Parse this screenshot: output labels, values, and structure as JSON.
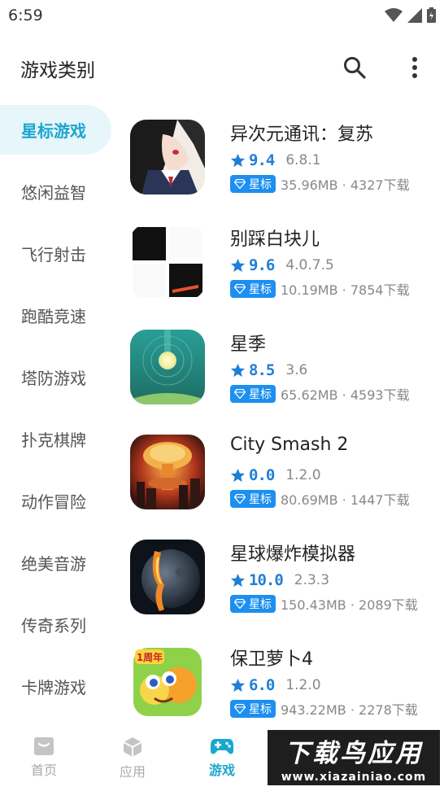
{
  "status_bar": {
    "time": "6:59",
    "icons": [
      "wifi-icon",
      "signal-icon",
      "battery-icon"
    ]
  },
  "header": {
    "title": "游戏类别",
    "actions": [
      "search-icon",
      "more-vertical-icon"
    ]
  },
  "sidebar": {
    "active_index": 0,
    "items": [
      {
        "label": "星标游戏"
      },
      {
        "label": "悠闲益智"
      },
      {
        "label": "飞行射击"
      },
      {
        "label": "跑酷竞速"
      },
      {
        "label": "塔防游戏"
      },
      {
        "label": "扑克棋牌"
      },
      {
        "label": "动作冒险"
      },
      {
        "label": "绝美音游"
      },
      {
        "label": "传奇系列"
      },
      {
        "label": "卡牌游戏"
      }
    ]
  },
  "apps": [
    {
      "name": "异次元通讯：复苏",
      "rating": "9.4",
      "version": "6.8.1",
      "badge": "星标",
      "size_downloads": "35.96MB · 4327下载",
      "icon": "anime-girl-icon"
    },
    {
      "name": "别踩白块儿",
      "rating": "9.6",
      "version": "4.0.7.5",
      "badge": "星标",
      "size_downloads": "10.19MB · 7854下载",
      "icon": "piano-tiles-icon"
    },
    {
      "name": "星季",
      "rating": "8.5",
      "version": "3.6",
      "badge": "星标",
      "size_downloads": "65.62MB · 4593下载",
      "icon": "glowing-orb-icon"
    },
    {
      "name": "City Smash 2",
      "rating": "0.0",
      "version": "1.2.0",
      "badge": "星标",
      "size_downloads": "80.69MB · 1447下载",
      "icon": "nuclear-explosion-icon"
    },
    {
      "name": "星球爆炸模拟器",
      "rating": "10.0",
      "version": "2.3.3",
      "badge": "星标",
      "size_downloads": "150.43MB · 2089下载",
      "icon": "exploding-planet-icon"
    },
    {
      "name": "保卫萝卜4",
      "rating": "6.0",
      "version": "1.2.0",
      "badge": "星标",
      "size_downloads": "943.22MB · 2278下载",
      "icon": "carrot-game-icon",
      "icon_text": "1周年"
    }
  ],
  "bottom_nav": {
    "active_index": 2,
    "items": [
      {
        "label": "首页",
        "icon": "home-icon"
      },
      {
        "label": "应用",
        "icon": "cube-icon"
      },
      {
        "label": "游戏",
        "icon": "gamepad-icon"
      }
    ]
  },
  "watermark": {
    "main": "下载鸟应用",
    "url": "www.xiazainiao.com"
  },
  "colors": {
    "accent": "#1aa7cf",
    "rating_blue": "#1f7fd6",
    "badge_blue": "#1d8ff0",
    "sidebar_active_bg": "#e7f6fa"
  }
}
